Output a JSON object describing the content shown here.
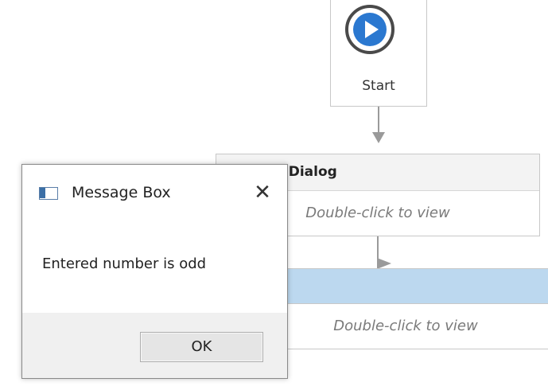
{
  "workflow": {
    "start_label": "Start",
    "input_dialog": {
      "title": "Input Dialog",
      "body": "Double-click to view"
    },
    "selected_activity": {
      "body": "Double-click to view"
    }
  },
  "message_box": {
    "title": "Message Box",
    "close_glyph": "✕",
    "message": "Entered number is odd",
    "ok_label": "OK"
  },
  "icons": {
    "play": "play-icon",
    "document": "document-icon",
    "window": "window-icon",
    "close": "close-icon"
  },
  "colors": {
    "play_blue": "#2b78d0",
    "selected_header": "#bcd8ef"
  }
}
